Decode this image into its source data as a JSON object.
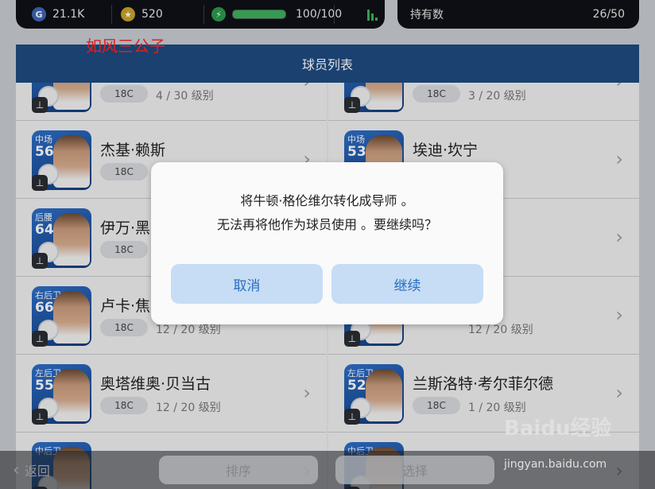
{
  "topbar": {
    "gp": {
      "icon": "gp-coin-icon",
      "letter": "G",
      "value": "21.1K"
    },
    "coins": {
      "icon": "gold-coin-icon",
      "value": "520"
    },
    "energy": {
      "icon": "energy-bolt-icon",
      "symbol": "⚡",
      "value": "100/100",
      "fill_fraction": 1.0
    },
    "ranking_icon": "bar-chart-icon",
    "holdings_label": "持有数",
    "holdings_value": "26/50"
  },
  "watermark_author": "如风三公子",
  "panel": {
    "title": "球员列表"
  },
  "players": [
    {
      "position": "",
      "rating": "",
      "name": "",
      "badge": "18C",
      "level": "4 / 30 级别"
    },
    {
      "position": "",
      "rating": "",
      "name": "",
      "badge": "18C",
      "level": "3 / 20 级别"
    },
    {
      "position": "中场",
      "rating": "56",
      "name": "杰基·赖斯",
      "badge": "18C",
      "level": ""
    },
    {
      "position": "中场",
      "rating": "53",
      "name": "埃迪·坎宁",
      "badge": "",
      "level": "级别"
    },
    {
      "position": "后腰",
      "rating": "64",
      "name": "伊万·黑",
      "badge": "18C",
      "level": ""
    },
    {
      "position": "",
      "rating": "",
      "name": "尔",
      "badge": "",
      "level": "级别"
    },
    {
      "position": "右后卫",
      "rating": "66",
      "name": "卢卡·焦",
      "badge": "18C",
      "level": "12 / 20 级别"
    },
    {
      "position": "",
      "rating": "",
      "name": "达",
      "badge": "",
      "level": "12 / 20 级别"
    },
    {
      "position": "左后卫",
      "rating": "55",
      "name": "奥塔维奥·贝当古",
      "badge": "18C",
      "level": "12 / 20 级别"
    },
    {
      "position": "左后卫",
      "rating": "52",
      "name": "兰斯洛特·考尔菲尔德",
      "badge": "18C",
      "level": "1 / 20 级别"
    },
    {
      "position": "中后卫",
      "rating": "",
      "name": "",
      "badge": "",
      "level": ""
    },
    {
      "position": "中后卫",
      "rating": "",
      "name": "",
      "badge": "",
      "level": ""
    }
  ],
  "bottombar": {
    "back_label": "返回",
    "sort_label": "排序",
    "select_label": "选择"
  },
  "baidu_watermark": {
    "logo": "Baidu经验",
    "url": "jingyan.baidu.com"
  },
  "dialog": {
    "line1": "将牛顿·格伦维尔转化成导师 。",
    "line2": "无法再将他作为球员使用 。要继续吗？",
    "cancel_label": "取消",
    "continue_label": "继续"
  }
}
